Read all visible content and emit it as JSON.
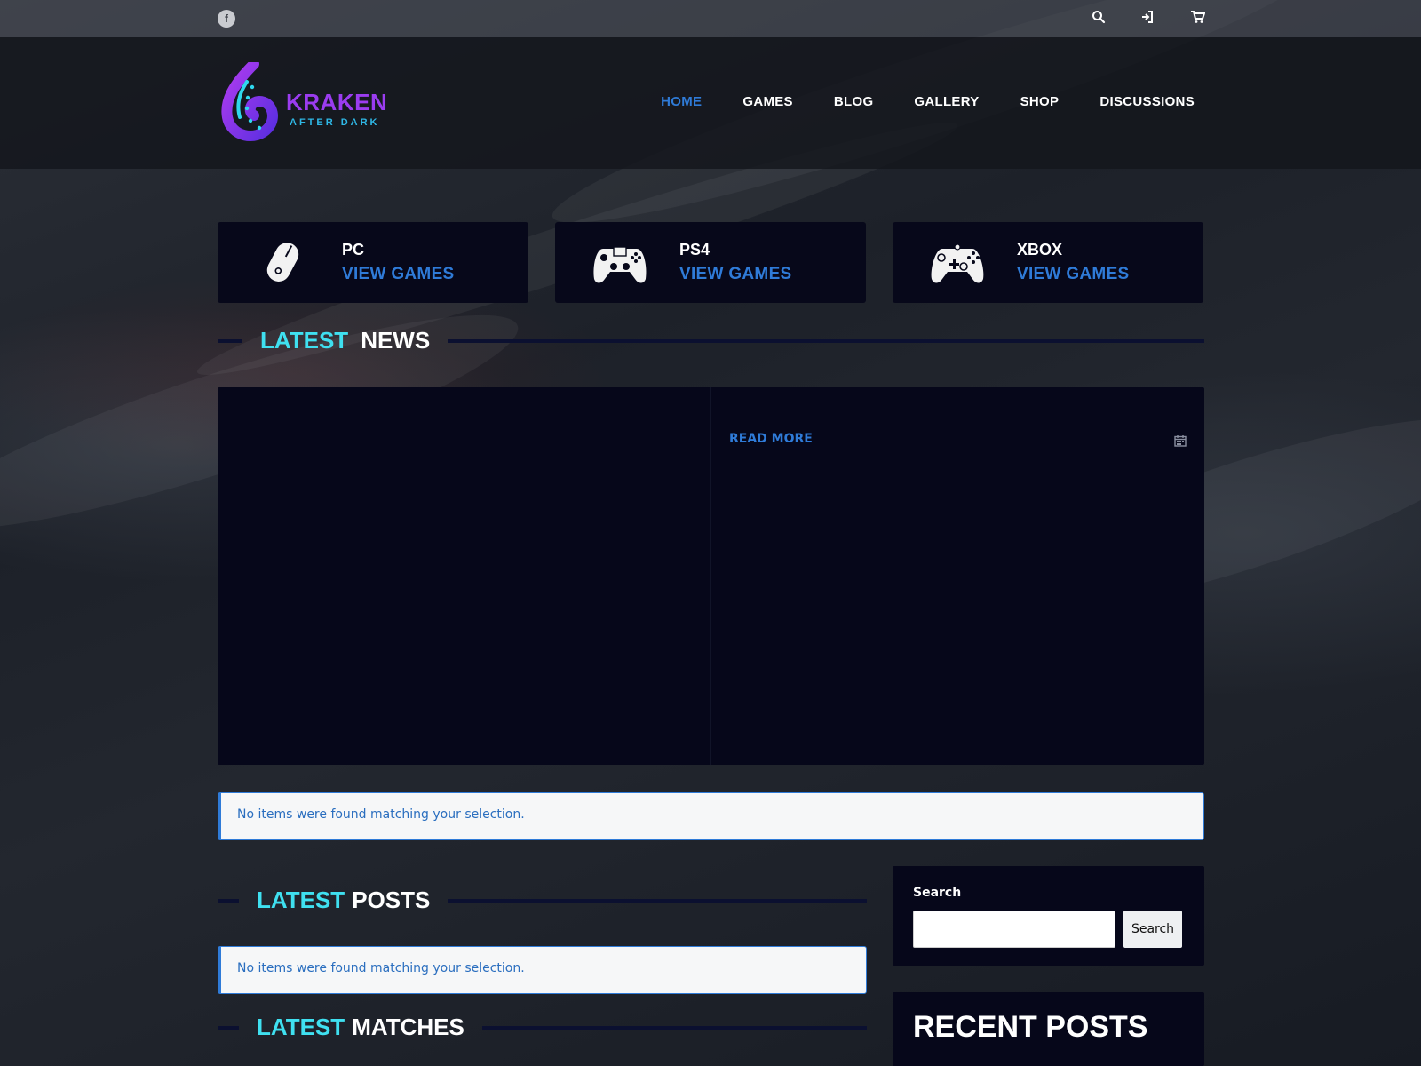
{
  "topbar": {
    "social_icon": "facebook-icon",
    "icons": [
      "search-icon",
      "login-icon",
      "cart-icon"
    ]
  },
  "brand": {
    "name": "KRAKEN",
    "tagline": "AFTER DARK",
    "colors": {
      "purple": "#9b3cf0",
      "cyan": "#2fb8e6"
    }
  },
  "nav": {
    "items": [
      "HOME",
      "GAMES",
      "BLOG",
      "GALLERY",
      "SHOP",
      "DISCUSSIONS"
    ],
    "active": "HOME"
  },
  "platforms": [
    {
      "name": "PC",
      "link": "VIEW GAMES",
      "icon": "mouse-icon"
    },
    {
      "name": "PS4",
      "link": "VIEW GAMES",
      "icon": "ps4-controller-icon"
    },
    {
      "name": "XBOX",
      "link": "VIEW GAMES",
      "icon": "xbox-controller-icon"
    }
  ],
  "latest_news": {
    "title_accent": "LATEST",
    "title_main": "NEWS",
    "read_more": "READ MORE",
    "date_icon": "calendar-icon"
  },
  "notices": {
    "news": "No items were found matching your selection.",
    "posts": "No items were found matching your selection."
  },
  "latest_posts": {
    "title_accent": "LATEST",
    "title_main": "POSTS"
  },
  "latest_matches": {
    "title_accent": "LATEST",
    "title_main": "MATCHES"
  },
  "sidebar": {
    "search": {
      "label": "Search",
      "placeholder": "",
      "value": "",
      "button": "Search"
    },
    "recent_posts_title": "RECENT POSTS"
  },
  "colors": {
    "accent_blue": "#2f7bd8",
    "accent_cyan": "#3fe0f0",
    "card_bg": "#07081a"
  }
}
